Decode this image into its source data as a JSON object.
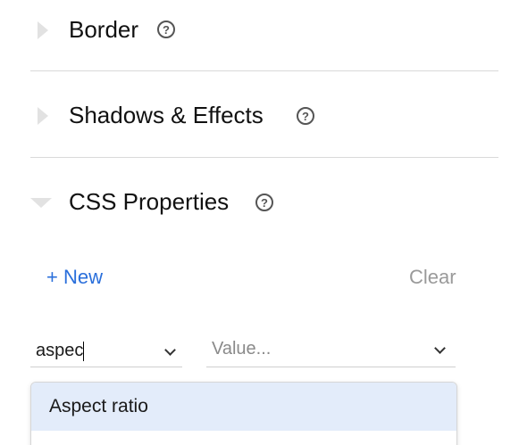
{
  "sections": [
    {
      "title": "Border",
      "expanded": false,
      "help_icon": "question-circle-icon"
    },
    {
      "title": "Shadows & Effects",
      "expanded": false,
      "help_icon": "question-circle-icon"
    },
    {
      "title": "CSS Properties",
      "expanded": true,
      "help_icon": "question-circle-icon"
    }
  ],
  "help_glyph": "?",
  "actions": {
    "new_label": "+ New",
    "clear_label": "Clear"
  },
  "property_input": {
    "value": "aspec",
    "icon": "chevron-down-icon"
  },
  "value_input": {
    "placeholder": "Value...",
    "icon": "chevron-down-icon"
  },
  "dropdown": {
    "options": [
      "Aspect ratio"
    ]
  },
  "colors": {
    "accent": "#2a6fdb",
    "muted": "#9a9a9a",
    "highlight": "#e3ecfa",
    "divider": "#d9d9d9"
  }
}
